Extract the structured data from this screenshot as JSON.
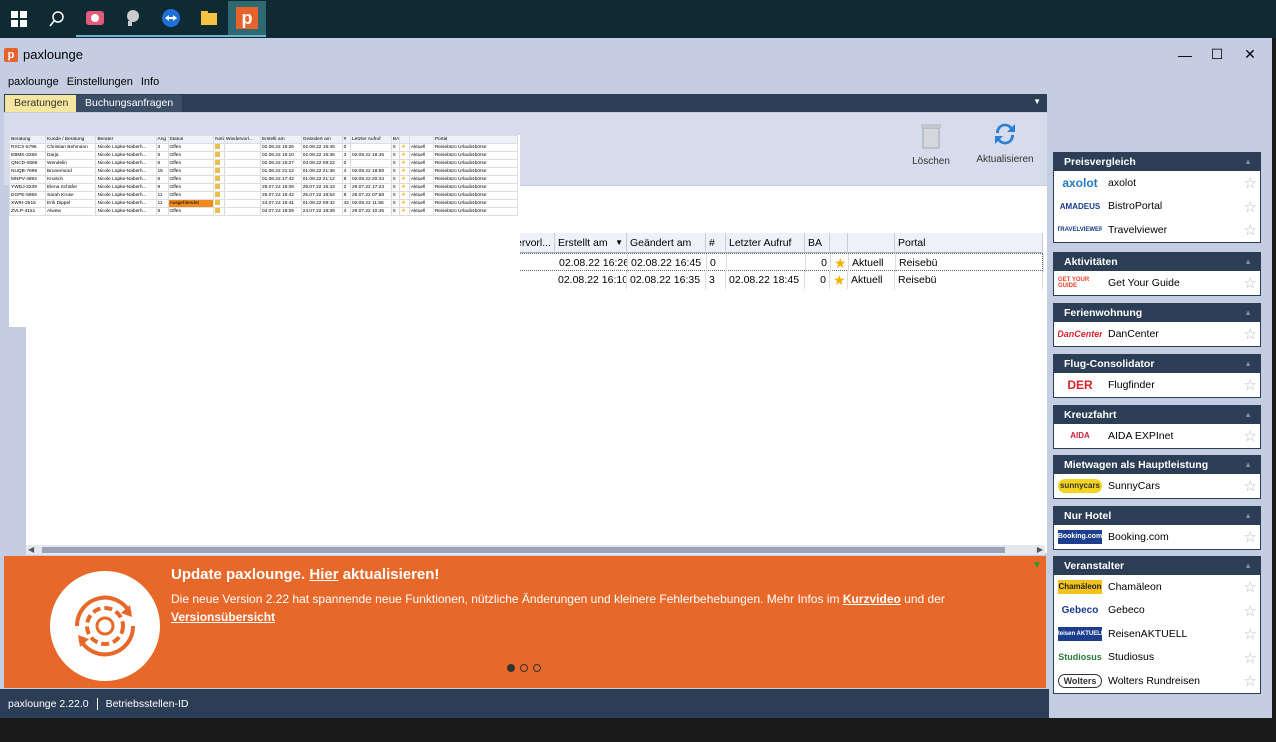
{
  "app": {
    "title": "paxlounge",
    "logo_letter": "p"
  },
  "menu": [
    "paxlounge",
    "Einstellungen",
    "Info"
  ],
  "tabs": [
    {
      "label": "Beratungen"
    },
    {
      "label": "Buchungsanfragen"
    }
  ],
  "toolbar": {
    "delete_label": "Löschen",
    "refresh_label": "Aktualisieren"
  },
  "grid": {
    "headers": [
      "ervorl...",
      "Erstellt am",
      "Geändert am",
      "#",
      "Letzter Aufruf",
      "BA",
      "",
      "",
      "Portal"
    ],
    "rows": [
      {
        "created": "02.08.22 16:26",
        "changed": "02.08.22 16:45",
        "count": "0",
        "last": "",
        "ba": "0",
        "status": "Aktuell",
        "portal": "Reisebü"
      },
      {
        "created": "02.08.22 16:10",
        "changed": "02.08.22 16:35",
        "count": "3",
        "last": "02.08.22 18:45",
        "ba": "0",
        "status": "Aktuell",
        "portal": "Reisebü"
      }
    ]
  },
  "mini": {
    "headers": [
      "Beratung",
      "Kunde / Beratung",
      "Berater",
      "Ang",
      "Status",
      "Notiz",
      "Wiedervorl...",
      "Erstellt am",
      "Geändert am",
      "#",
      "Letzter Aufruf",
      "BA",
      "",
      "",
      "Portal"
    ],
    "rows": [
      [
        "RXCS-5796",
        "Christian Behmann",
        "Nicole Lüpke-Naberh...",
        "3",
        "Offen",
        "",
        "",
        "02.08.22 16:26",
        "02.08.22 16:45",
        "0",
        "",
        "0",
        "",
        "Aktuell",
        "Reisebüro Urlaubsbörse"
      ],
      [
        "EBMK-2258",
        "Darja",
        "Nicole Lüpke-Naberh...",
        "5",
        "Offen",
        "",
        "",
        "02.08.22 16:10",
        "02.08.22 16:35",
        "3",
        "02.08.22 18:45",
        "0",
        "",
        "Aktuell",
        "Reisebüro Urlaubsbörse"
      ],
      [
        "QNCD-0586",
        "Wendelin",
        "Nicole Lüpke-Naberh...",
        "6",
        "Offen",
        "",
        "",
        "02.08.22 15:27",
        "03.08.22 09:22",
        "0",
        "",
        "0",
        "",
        "Aktuell",
        "Reisebüro Urlaubsbörse"
      ],
      [
        "NUQB-7696",
        "Brunemund",
        "Nicole Lüpke-Naberh...",
        "15",
        "Offen",
        "",
        "",
        "01.08.22 21:12",
        "01.08.22 21:36",
        "4",
        "02.08.22 18:59",
        "0",
        "",
        "Aktuell",
        "Reisebüro Urlaubsbörse"
      ],
      [
        "MNPV-4892",
        "Kruisch",
        "Nicole Lüpke-Naberh...",
        "6",
        "Offen",
        "",
        "",
        "01.08.22 17:42",
        "01.08.22 21:12",
        "8",
        "02.08.22 20:44",
        "0",
        "",
        "Aktuell",
        "Reisebüro Urlaubsbörse"
      ],
      [
        "YWDJ-3239",
        "Elena Schäfer",
        "Nicole Lüpke-Naberh...",
        "9",
        "Offen",
        "",
        "",
        "29.07.22 16:08",
        "29.07.22 16:43",
        "2",
        "29.07.22 17:23",
        "0",
        "",
        "Aktuell",
        "Reisebüro Urlaubsbörse"
      ],
      [
        "DGPE-5856",
        "Sarah Kruse",
        "Nicole Lüpke-Naberh...",
        "11",
        "Offen",
        "",
        "",
        "25.07.22 16:42",
        "25.07.22 18:54",
        "8",
        "28.07.22 07:58",
        "0",
        "",
        "Aktuell",
        "Reisebüro Urlaubsbörse"
      ],
      [
        "XWIH-2515",
        "Erik Dippel",
        "Nicole Lüpke-Naberh...",
        "11",
        "Ausgeblendet",
        "",
        "",
        "24.07.22 16:41",
        "01.08.22 09:42",
        "42",
        "02.08.22 11:56",
        "0",
        "",
        "Aktuell",
        "Reisebüro Urlaubsbörse"
      ],
      [
        "ZVLP-4151",
        "Alwew",
        "Nicole Lüpke-Naberh...",
        "5",
        "Offen",
        "",
        "",
        "04.07.22 18:09",
        "24.07.22 18:39",
        "4",
        "29.07.22 10:45",
        "0",
        "",
        "Aktuell",
        "Reisebüro Urlaubsbörse"
      ]
    ]
  },
  "banner": {
    "title_pre": "Update paxlounge. ",
    "title_link": "Hier",
    "title_post": " aktualisieren!",
    "text_pre": "Die neue Version 2.22 hat spannende neue Funktionen, nützliche Änderungen und kleinere Fehlerbehebungen. Mehr Infos im ",
    "text_link1": "Kurzvideo",
    "text_mid": " und der ",
    "text_link2": "Versionsübersicht"
  },
  "status": {
    "version": "paxlounge 2.22.0",
    "betrieb": "Betriebsstellen-ID"
  },
  "sidebar": [
    {
      "title": "Preisvergleich",
      "items": [
        {
          "logo": "axolot",
          "name": "axolot"
        },
        {
          "logo": "AMADEUS",
          "name": "BistroPortal"
        },
        {
          "logo": "TRAVELVIEWER",
          "name": "Travelviewer"
        }
      ]
    },
    {
      "title": "Aktivitäten",
      "items": [
        {
          "logo": "GET YOUR GUIDE",
          "name": "Get Your Guide"
        }
      ]
    },
    {
      "title": "Ferienwohnung",
      "items": [
        {
          "logo": "DanCenter",
          "name": "DanCenter"
        }
      ]
    },
    {
      "title": "Flug-Consolidator",
      "items": [
        {
          "logo": "DER",
          "name": "Flugfinder"
        }
      ]
    },
    {
      "title": "Kreuzfahrt",
      "items": [
        {
          "logo": "AIDA",
          "name": "AIDA EXPInet"
        }
      ]
    },
    {
      "title": "Mietwagen als Hauptleistung",
      "items": [
        {
          "logo": "sunnycars",
          "name": "SunnyCars"
        }
      ]
    },
    {
      "title": "Nur Hotel",
      "items": [
        {
          "logo": "Booking.com",
          "name": "Booking.com"
        }
      ]
    },
    {
      "title": "Veranstalter",
      "items": [
        {
          "logo": "Chamäleon",
          "name": "Chamäleon"
        },
        {
          "logo": "Gebeco",
          "name": "Gebeco"
        },
        {
          "logo": "Reisen AKTUELL",
          "name": "ReisenAKTUELL"
        },
        {
          "logo": "Studiosus",
          "name": "Studiosus"
        },
        {
          "logo": "Wolters",
          "name": "Wolters Rundreisen"
        }
      ]
    }
  ],
  "colors": {
    "accent": "#e8682a",
    "navy": "#2c3e56",
    "tab_active": "#f6e6a0",
    "window_bg": "#c5cde2"
  }
}
